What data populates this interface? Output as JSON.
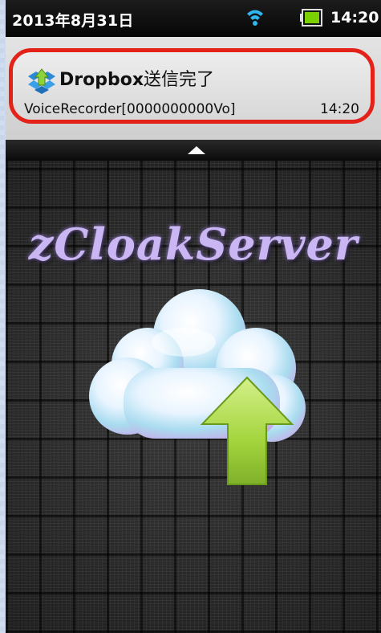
{
  "status_bar": {
    "date": "2013年8月31日",
    "time": "14:20",
    "wifi_icon": "wifi-icon",
    "battery_icon": "battery-icon",
    "battery_color": "#7ad000"
  },
  "notification": {
    "icon": "dropbox-icon",
    "title_app": "Dropbox",
    "title_suffix": "送信完了",
    "text": "VoiceRecorder[0000000000Vo]",
    "time": "14:20",
    "highlight_color": "#e3221a"
  },
  "app": {
    "title": "zCloakServer",
    "illustration": "cloud-upload-icon"
  }
}
